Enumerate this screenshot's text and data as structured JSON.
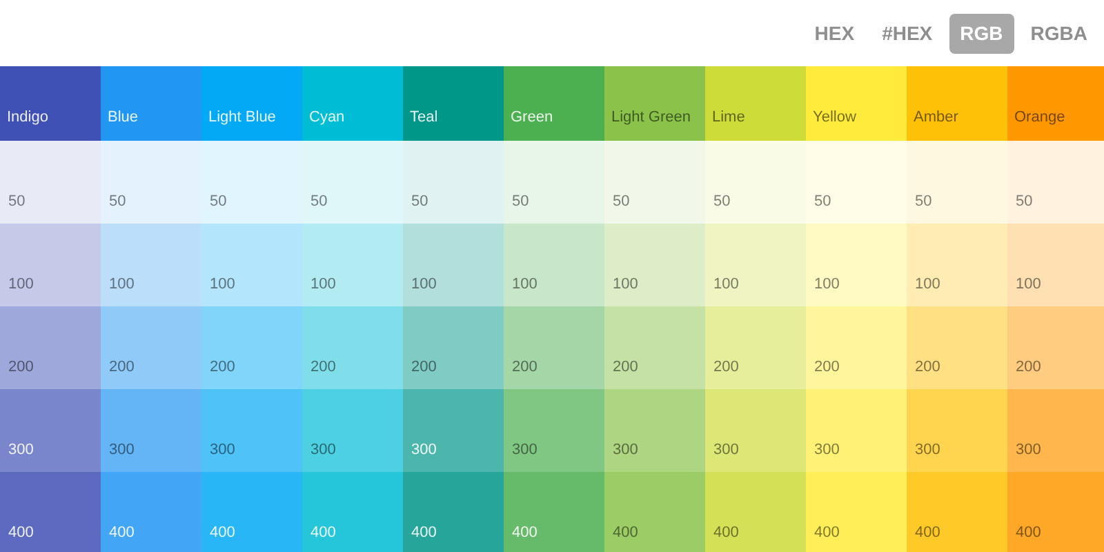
{
  "formats": [
    {
      "label": "HEX",
      "selected": false
    },
    {
      "label": "#HEX",
      "selected": false
    },
    {
      "label": "RGB",
      "selected": true
    },
    {
      "label": "RGBA",
      "selected": false
    }
  ],
  "palettes": [
    {
      "name": "Indigo",
      "color": "#3f51b5",
      "shades": [
        {
          "label": "50",
          "color": "#e8eaf6"
        },
        {
          "label": "100",
          "color": "#c5cae9"
        },
        {
          "label": "200",
          "color": "#9fa8da"
        },
        {
          "label": "300",
          "color": "#7986cb"
        },
        {
          "label": "400",
          "color": "#5c6bc0"
        }
      ]
    },
    {
      "name": "Blue",
      "color": "#2196f3",
      "shades": [
        {
          "label": "50",
          "color": "#e3f2fd"
        },
        {
          "label": "100",
          "color": "#bbdefb"
        },
        {
          "label": "200",
          "color": "#90caf9"
        },
        {
          "label": "300",
          "color": "#64b5f6"
        },
        {
          "label": "400",
          "color": "#42a5f5"
        }
      ]
    },
    {
      "name": "Light Blue",
      "color": "#03a9f4",
      "shades": [
        {
          "label": "50",
          "color": "#e1f5fe"
        },
        {
          "label": "100",
          "color": "#b3e5fc"
        },
        {
          "label": "200",
          "color": "#81d4fa"
        },
        {
          "label": "300",
          "color": "#4fc3f7"
        },
        {
          "label": "400",
          "color": "#29b6f6"
        }
      ]
    },
    {
      "name": "Cyan",
      "color": "#00bcd4",
      "shades": [
        {
          "label": "50",
          "color": "#e0f7fa"
        },
        {
          "label": "100",
          "color": "#b2ebf2"
        },
        {
          "label": "200",
          "color": "#80deea"
        },
        {
          "label": "300",
          "color": "#4dd0e1"
        },
        {
          "label": "400",
          "color": "#26c6da"
        }
      ]
    },
    {
      "name": "Teal",
      "color": "#009688",
      "shades": [
        {
          "label": "50",
          "color": "#e0f2f1"
        },
        {
          "label": "100",
          "color": "#b2dfdb"
        },
        {
          "label": "200",
          "color": "#80cbc4"
        },
        {
          "label": "300",
          "color": "#4db6ac"
        },
        {
          "label": "400",
          "color": "#26a69a"
        }
      ]
    },
    {
      "name": "Green",
      "color": "#4caf50",
      "shades": [
        {
          "label": "50",
          "color": "#e8f5e9"
        },
        {
          "label": "100",
          "color": "#c8e6c9"
        },
        {
          "label": "200",
          "color": "#a5d6a7"
        },
        {
          "label": "300",
          "color": "#81c784"
        },
        {
          "label": "400",
          "color": "#66bb6a"
        }
      ]
    },
    {
      "name": "Light Green",
      "color": "#8bc34a",
      "shades": [
        {
          "label": "50",
          "color": "#f1f8e9"
        },
        {
          "label": "100",
          "color": "#dcedc8"
        },
        {
          "label": "200",
          "color": "#c5e1a5"
        },
        {
          "label": "300",
          "color": "#aed581"
        },
        {
          "label": "400",
          "color": "#9ccc65"
        }
      ]
    },
    {
      "name": "Lime",
      "color": "#cddc39",
      "shades": [
        {
          "label": "50",
          "color": "#f9fbe7"
        },
        {
          "label": "100",
          "color": "#f0f4c3"
        },
        {
          "label": "200",
          "color": "#e6ee9c"
        },
        {
          "label": "300",
          "color": "#dce775"
        },
        {
          "label": "400",
          "color": "#d4e157"
        }
      ]
    },
    {
      "name": "Yellow",
      "color": "#ffeb3b",
      "shades": [
        {
          "label": "50",
          "color": "#fffde7"
        },
        {
          "label": "100",
          "color": "#fff9c4"
        },
        {
          "label": "200",
          "color": "#fff59d"
        },
        {
          "label": "300",
          "color": "#fff176"
        },
        {
          "label": "400",
          "color": "#ffee58"
        }
      ]
    },
    {
      "name": "Amber",
      "color": "#ffc107",
      "shades": [
        {
          "label": "50",
          "color": "#fff8e1"
        },
        {
          "label": "100",
          "color": "#ffecb3"
        },
        {
          "label": "200",
          "color": "#ffe082"
        },
        {
          "label": "300",
          "color": "#ffd54f"
        },
        {
          "label": "400",
          "color": "#ffca28"
        }
      ]
    },
    {
      "name": "Orange",
      "color": "#ff9800",
      "shades": [
        {
          "label": "50",
          "color": "#fff3e0"
        },
        {
          "label": "100",
          "color": "#ffe0b2"
        },
        {
          "label": "200",
          "color": "#ffcc80"
        },
        {
          "label": "300",
          "color": "#ffb74d"
        },
        {
          "label": "400",
          "color": "#ffa726"
        }
      ]
    }
  ]
}
